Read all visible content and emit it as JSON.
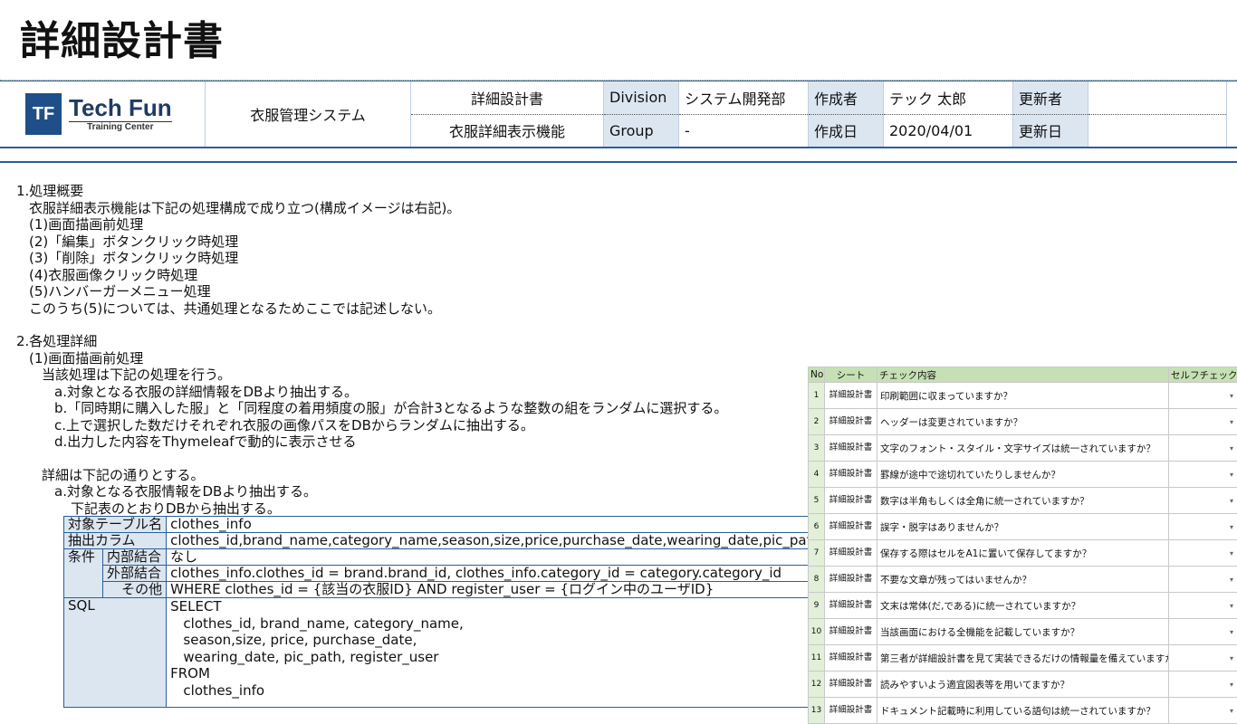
{
  "page_title": "詳細設計書",
  "header": {
    "logo": {
      "name": "Tech Fun",
      "sub": "Training Center",
      "mark": "TF"
    },
    "system": "衣服管理システム",
    "doc_type": "詳細設計書",
    "feature": "衣服詳細表示機能",
    "division_label": "Division",
    "division_value": "システム開発部",
    "group_label": "Group",
    "group_value": "-",
    "author_label": "作成者",
    "author_value": "テック 太郎",
    "created_label": "作成日",
    "created_value": "2020/04/01",
    "updater_label": "更新者",
    "updater_value": "",
    "updated_label": "更新日",
    "updated_value": ""
  },
  "body": {
    "s1_title": "1.処理概要",
    "s1_intro": "衣服詳細表示機能は下記の処理構成で成り立つ(構成イメージは右記)。",
    "s1_items": [
      "(1)画面描画前処理",
      "(2)「編集」ボタンクリック時処理",
      "(3)「削除」ボタンクリック時処理",
      "(4)衣服画像クリック時処理",
      "(5)ハンバーガーメニュー処理"
    ],
    "s1_note": "このうち(5)については、共通処理となるためここでは記述しない。",
    "s2_title": "2.各処理詳細",
    "s2_sub": "(1)画面描画前処理",
    "s2_desc": "当該処理は下記の処理を行う。",
    "s2_steps": [
      "a.対象となる衣服の詳細情報をDBより抽出する。",
      "b.「同時期に購入した服」と「同程度の着用頻度の服」が合計3となるような整数の組をランダムに選択する。",
      "c.上で選択した数だけそれぞれ衣服の画像パスをDBからランダムに抽出する。",
      "d.出力した内容をThymeleafで動的に表示させる"
    ],
    "s2_detail": "詳細は下記の通りとする。",
    "s2_a": "a.対象となる衣服情報をDBより抽出する。",
    "s2_a_note": "下記表のとおりDBから抽出する。"
  },
  "db_table": {
    "target_label": "対象テーブル名",
    "target_value": "clothes_info",
    "columns_label": "抽出カラム",
    "columns_value": "clothes_id,brand_name,category_name,season,size,price,purchase_date,wearing_date,pic_path,regi",
    "cond_label": "条件",
    "inner_label": "内部結合",
    "inner_value": "なし",
    "outer_label": "外部結合",
    "outer_value": "clothes_info.clothes_id = brand.brand_id, clothes_info.category_id = category.category_id",
    "other_label": "その他",
    "other_value": "WHERE clothes_id = {該当の衣服ID} AND register_user = {ログイン中のユーザID}",
    "sql_label": "SQL",
    "sql_lines": [
      "SELECT",
      "   clothes_id, brand_name, category_name,",
      "   season,size, price, purchase_date,",
      "   wearing_date, pic_path, register_user",
      "FROM",
      "   clothes_info"
    ]
  },
  "checklist": {
    "headers": {
      "no": "No",
      "sheet": "シート",
      "content": "チェック内容",
      "self": "セルフチェック"
    },
    "rows": [
      {
        "no": "1",
        "sheet": "詳細設計書",
        "content": "印刷範囲に収まっていますか？"
      },
      {
        "no": "2",
        "sheet": "詳細設計書",
        "content": "ヘッダーは変更されていますか？"
      },
      {
        "no": "3",
        "sheet": "詳細設計書",
        "content": "文字のフォント・スタイル・文字サイズは統一されていますか？"
      },
      {
        "no": "4",
        "sheet": "詳細設計書",
        "content": "罫線が途中で途切れていたりしませんか？"
      },
      {
        "no": "5",
        "sheet": "詳細設計書",
        "content": "数字は半角もしくは全角に統一されていますか？"
      },
      {
        "no": "6",
        "sheet": "詳細設計書",
        "content": "誤字・脱字はありませんか？"
      },
      {
        "no": "7",
        "sheet": "詳細設計書",
        "content": "保存する際はセルをA1に置いて保存してますか？"
      },
      {
        "no": "8",
        "sheet": "詳細設計書",
        "content": "不要な文章が残ってはいませんか？"
      },
      {
        "no": "9",
        "sheet": "詳細設計書",
        "content": "文末は常体(だ,である)に統一されていますか？"
      },
      {
        "no": "10",
        "sheet": "詳細設計書",
        "content": "当該画面における全機能を記載していますか？"
      },
      {
        "no": "11",
        "sheet": "詳細設計書",
        "content": "第三者が詳細設計書を見て実装できるだけの情報量を備えていますか？"
      },
      {
        "no": "12",
        "sheet": "詳細設計書",
        "content": "読みやすいよう適宜図表等を用いてますか？"
      },
      {
        "no": "13",
        "sheet": "詳細設計書",
        "content": "ドキュメント記載時に利用している語句は統一されていますか？"
      }
    ]
  }
}
